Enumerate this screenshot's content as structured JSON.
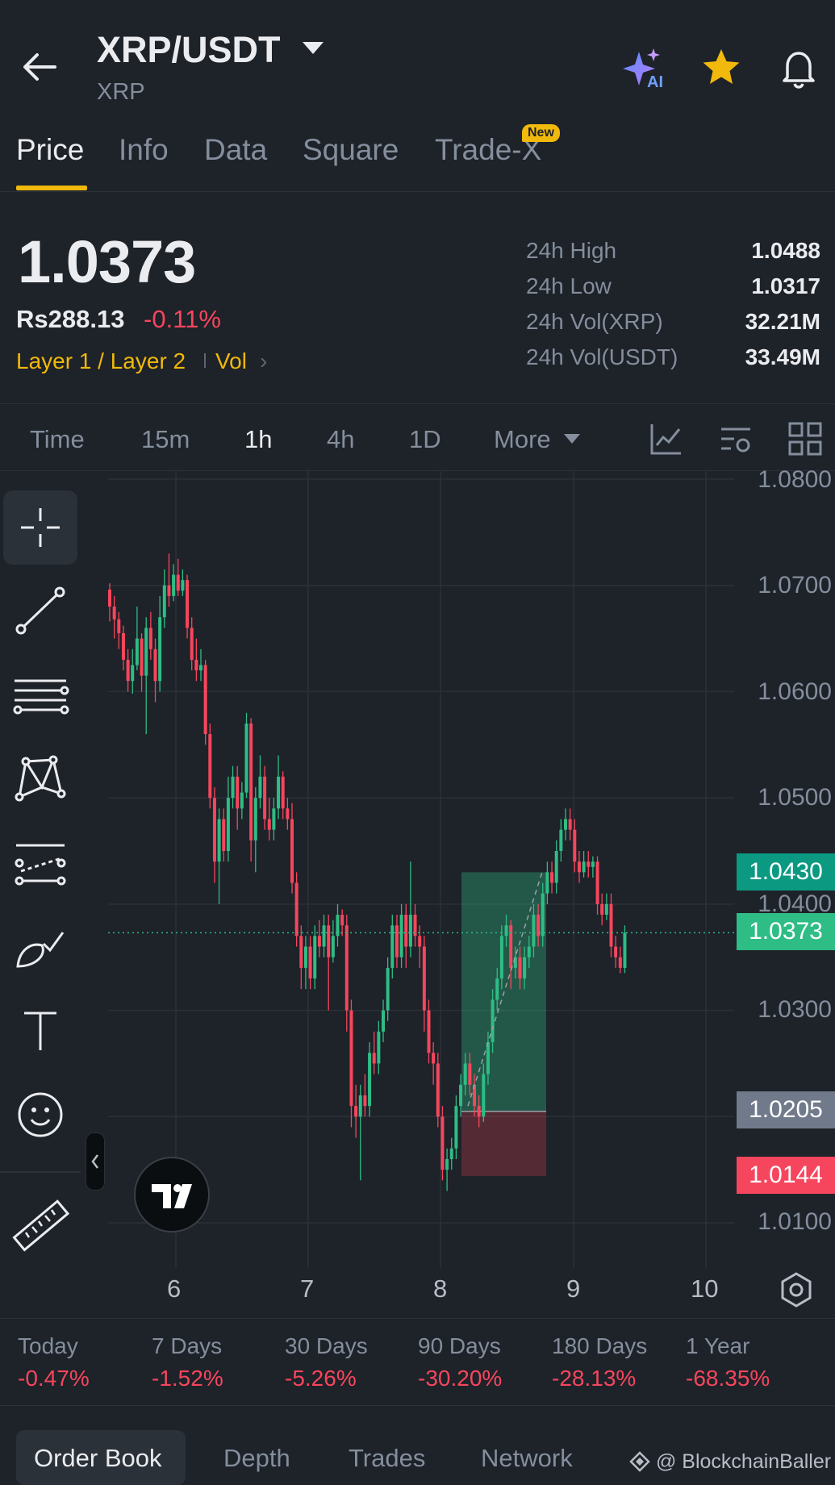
{
  "header": {
    "pair": "XRP/USDT",
    "base": "XRP",
    "icons": [
      "back-arrow-icon",
      "ai-sparkle-icon",
      "star-icon",
      "bell-icon"
    ]
  },
  "tabs": [
    {
      "label": "Price"
    },
    {
      "label": "Info"
    },
    {
      "label": "Data"
    },
    {
      "label": "Square"
    },
    {
      "label": "Trade-X"
    }
  ],
  "new_badge": "New",
  "price": {
    "last": "1.0373",
    "local": "Rs288.13",
    "change": "-0.11%",
    "category1": "Layer 1 / Layer 2",
    "category2": "Vol"
  },
  "stats": [
    {
      "label": "24h High",
      "value": "1.0488"
    },
    {
      "label": "24h Low",
      "value": "1.0317"
    },
    {
      "label": "24h Vol(XRP)",
      "value": "32.21M"
    },
    {
      "label": "24h Vol(USDT)",
      "value": "33.49M"
    }
  ],
  "intervals": [
    "Time",
    "15m",
    "1h",
    "4h",
    "1D",
    "More"
  ],
  "active_interval": "1h",
  "chart_data": {
    "type": "candlestick",
    "y_ticks": [
      "1.0800",
      "1.0700",
      "1.0600",
      "1.0500",
      "1.0400",
      "1.0300",
      "1.0100"
    ],
    "x_ticks": [
      "6",
      "7",
      "8",
      "9",
      "10"
    ],
    "ylim": [
      1.0073,
      1.081
    ],
    "price_tags": [
      {
        "value": "1.0430",
        "color": "#0b9981"
      },
      {
        "value": "1.0373",
        "color": "#2ebd85"
      },
      {
        "value": "1.0205",
        "color": "#707a8a"
      },
      {
        "value": "1.0144",
        "color": "#f6465d"
      }
    ],
    "current_price": 1.0373,
    "candles": [
      [
        1.0696,
        1.068,
        1.0702,
        1.0666
      ],
      [
        1.068,
        1.0668,
        1.069,
        1.065
      ],
      [
        1.0668,
        1.0655,
        1.0675,
        1.064
      ],
      [
        1.0655,
        1.063,
        1.0662,
        1.062
      ],
      [
        1.063,
        1.061,
        1.064,
        1.06
      ],
      [
        1.061,
        1.0625,
        1.064,
        1.0598
      ],
      [
        1.0625,
        1.065,
        1.068,
        1.062
      ],
      [
        1.065,
        1.0615,
        1.0655,
        1.06
      ],
      [
        1.0615,
        1.066,
        1.067,
        1.056
      ],
      [
        1.066,
        1.064,
        1.0675,
        1.063
      ],
      [
        1.064,
        1.061,
        1.065,
        1.059
      ],
      [
        1.061,
        1.067,
        1.069,
        1.06
      ],
      [
        1.067,
        1.07,
        1.0715,
        1.066
      ],
      [
        1.07,
        1.069,
        1.073,
        1.068
      ],
      [
        1.069,
        1.071,
        1.072,
        1.0685
      ],
      [
        1.071,
        1.0695,
        1.0725,
        1.069
      ],
      [
        1.0695,
        1.0705,
        1.0715,
        1.069
      ],
      [
        1.0705,
        1.066,
        1.071,
        1.065
      ],
      [
        1.066,
        1.063,
        1.067,
        1.062
      ],
      [
        1.063,
        1.062,
        1.065,
        1.061
      ],
      [
        1.062,
        1.0625,
        1.064,
        1.061
      ],
      [
        1.0625,
        1.056,
        1.063,
        1.055
      ],
      [
        1.056,
        1.05,
        1.057,
        1.049
      ],
      [
        1.05,
        1.044,
        1.051,
        1.042
      ],
      [
        1.044,
        1.048,
        1.049,
        1.04
      ],
      [
        1.048,
        1.045,
        1.049,
        1.044
      ],
      [
        1.045,
        1.05,
        1.052,
        1.044
      ],
      [
        1.05,
        1.052,
        1.053,
        1.049
      ],
      [
        1.052,
        1.049,
        1.053,
        1.047
      ],
      [
        1.049,
        1.0505,
        1.0515,
        1.048
      ],
      [
        1.0505,
        1.057,
        1.058,
        1.05
      ],
      [
        1.057,
        1.046,
        1.0575,
        1.044
      ],
      [
        1.046,
        1.05,
        1.051,
        1.043
      ],
      [
        1.05,
        1.052,
        1.054,
        1.049
      ],
      [
        1.052,
        1.048,
        1.053,
        1.047
      ],
      [
        1.048,
        1.047,
        1.05,
        1.046
      ],
      [
        1.047,
        1.049,
        1.05,
        1.046
      ],
      [
        1.049,
        1.052,
        1.054,
        1.048
      ],
      [
        1.052,
        1.049,
        1.0525,
        1.048
      ],
      [
        1.049,
        1.048,
        1.05,
        1.047
      ],
      [
        1.048,
        1.042,
        1.0495,
        1.041
      ],
      [
        1.042,
        1.037,
        1.043,
        1.036
      ],
      [
        1.037,
        1.034,
        1.038,
        1.032
      ],
      [
        1.034,
        1.036,
        1.037,
        1.032
      ],
      [
        1.036,
        1.033,
        1.037,
        1.032
      ],
      [
        1.033,
        1.037,
        1.038,
        1.032
      ],
      [
        1.037,
        1.036,
        1.0385,
        1.035
      ],
      [
        1.036,
        1.038,
        1.039,
        1.035
      ],
      [
        1.038,
        1.035,
        1.039,
        1.03
      ],
      [
        1.035,
        1.037,
        1.0385,
        1.0345
      ],
      [
        1.037,
        1.039,
        1.04,
        1.036
      ],
      [
        1.039,
        1.038,
        1.0395,
        1.037
      ],
      [
        1.038,
        1.03,
        1.039,
        1.028
      ],
      [
        1.03,
        1.021,
        1.031,
        1.019
      ],
      [
        1.021,
        1.02,
        1.023,
        1.018
      ],
      [
        1.02,
        1.022,
        1.023,
        1.014
      ],
      [
        1.022,
        1.021,
        1.024,
        1.02
      ],
      [
        1.021,
        1.026,
        1.027,
        1.02
      ],
      [
        1.026,
        1.025,
        1.028,
        1.024
      ],
      [
        1.025,
        1.028,
        1.029,
        1.024
      ],
      [
        1.028,
        1.03,
        1.031,
        1.027
      ],
      [
        1.03,
        1.034,
        1.035,
        1.029
      ],
      [
        1.034,
        1.038,
        1.039,
        1.033
      ],
      [
        1.038,
        1.035,
        1.039,
        1.034
      ],
      [
        1.035,
        1.039,
        1.04,
        1.034
      ],
      [
        1.039,
        1.036,
        1.04,
        1.034
      ],
      [
        1.036,
        1.039,
        1.044,
        1.035
      ],
      [
        1.039,
        1.037,
        1.04,
        1.036
      ],
      [
        1.037,
        1.036,
        1.038,
        1.034
      ],
      [
        1.036,
        1.03,
        1.037,
        1.028
      ],
      [
        1.03,
        1.026,
        1.031,
        1.025
      ],
      [
        1.026,
        1.025,
        1.027,
        1.023
      ],
      [
        1.025,
        1.02,
        1.026,
        1.019
      ],
      [
        1.02,
        1.015,
        1.021,
        1.014
      ],
      [
        1.015,
        1.016,
        1.017,
        1.013
      ],
      [
        1.016,
        1.017,
        1.018,
        1.015
      ],
      [
        1.017,
        1.021,
        1.022,
        1.016
      ],
      [
        1.021,
        1.023,
        1.024,
        1.02
      ],
      [
        1.023,
        1.025,
        1.026,
        1.022
      ],
      [
        1.025,
        1.023,
        1.026,
        1.022
      ],
      [
        1.023,
        1.021,
        1.024,
        1.02
      ],
      [
        1.021,
        1.02,
        1.022,
        1.019
      ],
      [
        1.02,
        1.024,
        1.025,
        1.0195
      ],
      [
        1.024,
        1.027,
        1.028,
        1.023
      ],
      [
        1.027,
        1.031,
        1.032,
        1.026
      ],
      [
        1.031,
        1.033,
        1.034,
        1.03
      ],
      [
        1.033,
        1.037,
        1.038,
        1.032
      ],
      [
        1.037,
        1.038,
        1.039,
        1.036
      ],
      [
        1.038,
        1.034,
        1.0385,
        1.032
      ],
      [
        1.034,
        1.035,
        1.036,
        1.033
      ],
      [
        1.035,
        1.033,
        1.036,
        1.032
      ],
      [
        1.033,
        1.035,
        1.036,
        1.032
      ],
      [
        1.035,
        1.036,
        1.037,
        1.034
      ],
      [
        1.036,
        1.039,
        1.04,
        1.035
      ],
      [
        1.039,
        1.037,
        1.04,
        1.036
      ],
      [
        1.037,
        1.041,
        1.042,
        1.036
      ],
      [
        1.041,
        1.043,
        1.044,
        1.04
      ],
      [
        1.043,
        1.042,
        1.044,
        1.041
      ],
      [
        1.042,
        1.045,
        1.046,
        1.041
      ],
      [
        1.045,
        1.047,
        1.048,
        1.044
      ],
      [
        1.047,
        1.048,
        1.049,
        1.046
      ],
      [
        1.048,
        1.047,
        1.049,
        1.046
      ],
      [
        1.047,
        1.044,
        1.048,
        1.043
      ],
      [
        1.044,
        1.043,
        1.045,
        1.042
      ],
      [
        1.043,
        1.044,
        1.045,
        1.0425
      ],
      [
        1.044,
        1.0435,
        1.045,
        1.0425
      ],
      [
        1.0435,
        1.044,
        1.0445,
        1.0425
      ],
      [
        1.044,
        1.04,
        1.0445,
        1.039
      ],
      [
        1.04,
        1.039,
        1.041,
        1.038
      ],
      [
        1.039,
        1.04,
        1.041,
        1.0385
      ],
      [
        1.04,
        1.036,
        1.041,
        1.035
      ],
      [
        1.036,
        1.035,
        1.037,
        1.034
      ],
      [
        1.035,
        1.034,
        1.036,
        1.0335
      ],
      [
        1.034,
        1.0373,
        1.038,
        1.0335
      ]
    ]
  },
  "performance": [
    {
      "label": "Today",
      "value": "-0.47%"
    },
    {
      "label": "7 Days",
      "value": "-1.52%"
    },
    {
      "label": "30 Days",
      "value": "-5.26%"
    },
    {
      "label": "90 Days",
      "value": "-30.20%"
    },
    {
      "label": "180 Days",
      "value": "-28.13%"
    },
    {
      "label": "1 Year",
      "value": "-68.35%"
    }
  ],
  "bottom_tabs": [
    "Order Book",
    "Depth",
    "Trades",
    "Network"
  ],
  "watermark": "@ BlockchainBaller",
  "colors": {
    "up": "#2ebd85",
    "down": "#f6465d",
    "accent": "#f0b90b",
    "bg": "#1e2229"
  }
}
